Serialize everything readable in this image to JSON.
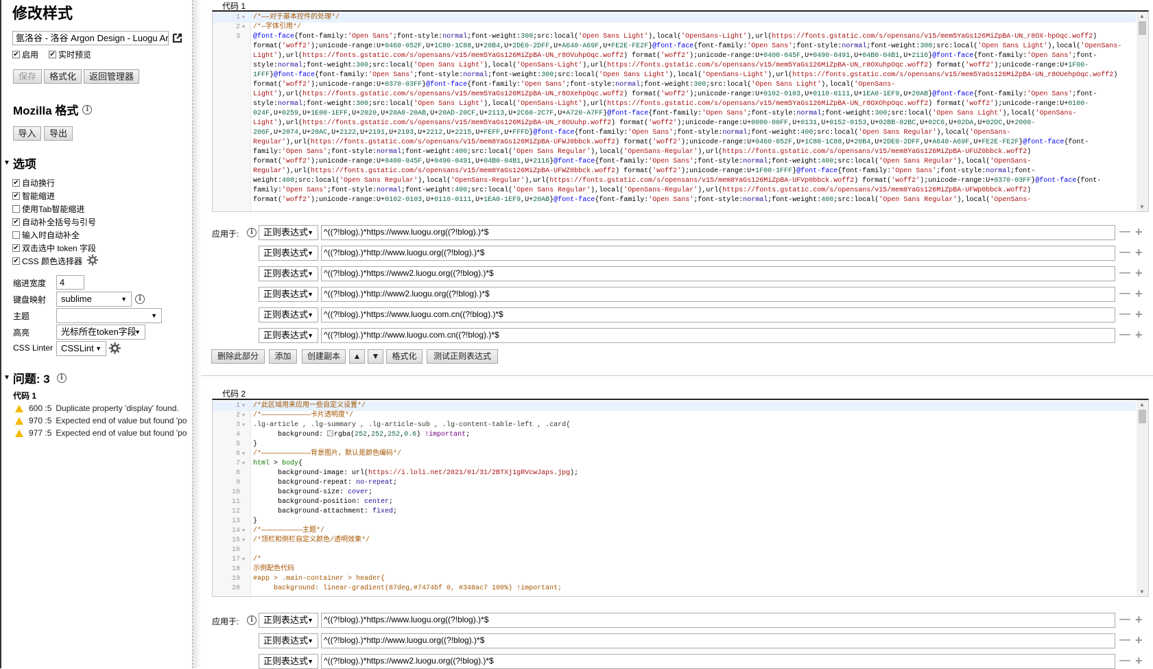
{
  "sidebar": {
    "title": "修改样式",
    "style_name": "氩洛谷 - 洛谷 Argon Design - Luogu Argo",
    "enabled_label": "启用",
    "live_preview_label": "实时预览",
    "save_label": "保存",
    "beautify_label": "格式化",
    "back_label": "返回管理器",
    "mozilla_title": "Mozilla 格式",
    "import_label": "导入",
    "export_label": "导出",
    "options_title": "选项",
    "options": [
      {
        "label": "自动换行",
        "checked": true
      },
      {
        "label": "智能缩进",
        "checked": true
      },
      {
        "label": "使用Tab智能缩进",
        "checked": false
      },
      {
        "label": "自动补全括号与引号",
        "checked": true
      },
      {
        "label": "输入时自动补全",
        "checked": false
      },
      {
        "label": "双击选中 token 字段",
        "checked": true
      },
      {
        "label": "CSS 颜色选择器",
        "checked": true
      }
    ],
    "indent_label": "缩进宽度",
    "indent_value": "4",
    "keymap_label": "键盘映射",
    "keymap_value": "sublime",
    "theme_label": "主题",
    "theme_value": "",
    "highlight_label": "高亮",
    "highlight_value": "光标所在token字段",
    "linter_label": "CSS Linter",
    "linter_value": "CSSLint",
    "issues_title": "问题: 3",
    "issues_section": "代码 1",
    "issues": [
      {
        "pos": "600 :5",
        "msg": "Duplicate property 'display' found."
      },
      {
        "pos": "970 :5",
        "msg": "Expected end of value but found 'po"
      },
      {
        "pos": "977 :5",
        "msg": "Expected end of value but found 'po"
      }
    ]
  },
  "sections": [
    {
      "label": "代码 1",
      "rows": [
        {
          "n": "1",
          "fold": true,
          "t": "/*——对于基本控件的处理*/"
        },
        {
          "n": "2",
          "fold": true,
          "t": "/*—字体引用*/"
        },
        {
          "n": "3",
          "fold": false,
          "t": "@font-face{font-family:'Open Sans';font-style:normal;font-weight:300;src:local('Open Sans Light'),local('OpenSans-Light'),url(https://fonts.gstatic.com/s/opensans/v15/mem5YaGs126MiZpBA-UN_r8OX-hpOqc.woff2)"
        },
        {
          "n": "",
          "t": "format('woff2');unicode-range:U+0460-052F,U+1C80-1C88,U+20B4,U+2DE0-2DFF,U+A640-A69F,U+FE2E-FE2F}@font-face{font-family:'Open Sans';font-style:normal;font-weight:300;src:local('Open Sans Light'),local('OpenSans-"
        },
        {
          "n": "",
          "t": "Light'),url(https://fonts.gstatic.com/s/opensans/v15/mem5YaGs126MiZpBA-UN_r8OVuhpOqc.woff2) format('woff2');unicode-range:U+0400-045F,U+0490-0491,U+04B0-04B1,U+2116}@font-face{font-family:'Open Sans';font-"
        },
        {
          "n": "",
          "t": "style:normal;font-weight:300;src:local('Open Sans Light'),local('OpenSans-Light'),url(https://fonts.gstatic.com/s/opensans/v15/mem5YaGs126MiZpBA-UN_r8OXuhpOqc.woff2) format('woff2');unicode-range:U+1F00-"
        },
        {
          "n": "",
          "t": "1FFF}@font-face{font-family:'Open Sans';font-style:normal;font-weight:300;src:local('Open Sans Light'),local('OpenSans-Light'),url(https://fonts.gstatic.com/s/opensans/v15/mem5YaGs126MiZpBA-UN_r8OUehpOqc.woff2)"
        },
        {
          "n": "",
          "t": "format('woff2');unicode-range:U+0370-03FF}@font-face{font-family:'Open Sans';font-style:normal;font-weight:300;src:local('Open Sans Light'),local('OpenSans-"
        },
        {
          "n": "",
          "t": "Light'),url(https://fonts.gstatic.com/s/opensans/v15/mem5YaGs126MiZpBA-UN_r8OXehpOqc.woff2) format('woff2');unicode-range:U+0102-0103,U+0110-0111,U+1EA0-1EF9,U+20AB}@font-face{font-family:'Open Sans';font-"
        },
        {
          "n": "",
          "t": "style:normal;font-weight:300;src:local('Open Sans Light'),local('OpenSans-Light'),url(https://fonts.gstatic.com/s/opensans/v15/mem5YaGs126MiZpBA-UN_r8OXOhpOqc.woff2) format('woff2');unicode-range:U+0100-"
        },
        {
          "n": "",
          "t": "024F,U+0259,U+1E00-1EFF,U+2020,U+20A0-20AB,U+20AD-20CF,U+2113,U+2C60-2C7F,U+A720-A7FF}@font-face{font-family:'Open Sans';font-style:normal;font-weight:300;src:local('Open Sans Light'),local('OpenSans-"
        },
        {
          "n": "",
          "t": "Light'),url(https://fonts.gstatic.com/s/opensans/v15/mem5YaGs126MiZpBA-UN_r8OUuhp.woff2) format('woff2');unicode-range:U+0000-00FF,U+0131,U+0152-0153,U+02BB-02BC,U+02C6,U+02DA,U+02DC,U+2000-"
        },
        {
          "n": "",
          "t": "206F,U+2074,U+20AC,U+2122,U+2191,U+2193,U+2212,U+2215,U+FEFF,U+FFFD}@font-face{font-family:'Open Sans';font-style:normal;font-weight:400;src:local('Open Sans Regular'),local('OpenSans-"
        },
        {
          "n": "",
          "t": "Regular'),url(https://fonts.gstatic.com/s/opensans/v15/mem8YaGs126MiZpBA-UFWJ0bbck.woff2) format('woff2');unicode-range:U+0460-052F,U+1C80-1C88,U+20B4,U+2DE0-2DFF,U+A640-A69F,U+FE2E-FE2F}@font-face{font-"
        },
        {
          "n": "",
          "t": "family:'Open Sans';font-style:normal;font-weight:400;src:local('Open Sans Regular'),local('OpenSans-Regular'),url(https://fonts.gstatic.com/s/opensans/v15/mem8YaGs126MiZpBA-UFUZ0bbck.woff2)"
        },
        {
          "n": "",
          "t": "format('woff2');unicode-range:U+0400-045F,U+0490-0491,U+04B0-04B1,U+2116}@font-face{font-family:'Open Sans';font-style:normal;font-weight:400;src:local('Open Sans Regular'),local('OpenSans-"
        },
        {
          "n": "",
          "t": "Regular'),url(https://fonts.gstatic.com/s/opensans/v15/mem8YaGs126MiZpBA-UFWZ0bbck.woff2) format('woff2');unicode-range:U+1F00-1FFF}@font-face{font-family:'Open Sans';font-style:normal;font-"
        },
        {
          "n": "",
          "t": "weight:400;src:local('Open Sans Regular'),local('OpenSans-Regular'),url(https://fonts.gstatic.com/s/opensans/v15/mem8YaGs126MiZpBA-UFVp0bbck.woff2) format('woff2');unicode-range:U+0370-03FF}@font-face{font-"
        },
        {
          "n": "",
          "t": "family:'Open Sans';font-style:normal;font-weight:400;src:local('Open Sans Regular'),local('OpenSans-Regular'),url(https://fonts.gstatic.com/s/opensans/v15/mem8YaGs126MiZpBA-UFWp0bbck.woff2)"
        },
        {
          "n": "",
          "t": "format('woff2');unicode-range:U+0102-0103,U+0110-0111,U+1EA0-1EF9,U+20AB}@font-face{font-family:'Open Sans';font-style:normal;font-weight:400;src:local('Open Sans Regular'),local('OpenSans-"
        }
      ],
      "applies_label": "应用于:",
      "applies": [
        {
          "type": "正则表达式",
          "value": "^((?!blog).)*https://www.luogu.org((?!blog).)*$"
        },
        {
          "type": "正则表达式",
          "value": "^((?!blog).)*http://www.luogu.org((?!blog).)*$"
        },
        {
          "type": "正则表达式",
          "value": "^((?!blog).)*https://www2.luogu.org((?!blog).)*$"
        },
        {
          "type": "正则表达式",
          "value": "^((?!blog).)*http://www2.luogu.org((?!blog).)*$"
        },
        {
          "type": "正则表达式",
          "value": "^((?!blog).)*https://www.luogu.com.cn((?!blog).)*$"
        },
        {
          "type": "正则表达式",
          "value": "^((?!blog).)*http://www.luogu.com.cn((?!blog).)*$"
        }
      ],
      "buttons": [
        "删除此部分",
        "添加",
        "创建副本",
        "▲",
        "▼",
        "格式化",
        "测试正则表达式"
      ]
    },
    {
      "label": "代码 2",
      "rows": [
        {
          "n": "1",
          "fold": true,
          "t": "/*此区域用来应用一些自定义设置*/"
        },
        {
          "n": "2",
          "fold": true,
          "t": "/*————————————卡片透明度*/"
        },
        {
          "n": "3",
          "fold": true,
          "t": ".lg-article , .lg-summary , .lg-article-sub , .lg-content-table-left , .card{"
        },
        {
          "n": "4",
          "fold": false,
          "t": "      background: rgba(252,252,252,0.6) !important;"
        },
        {
          "n": "5",
          "fold": false,
          "t": "}"
        },
        {
          "n": "6",
          "fold": true,
          "t": "/*————————————背景图片，默认是颜色编码*/"
        },
        {
          "n": "7",
          "fold": true,
          "t": "html > body{"
        },
        {
          "n": "8",
          "fold": false,
          "t": "      background-image: url(https://i.loli.net/2021/01/31/2BTXj1gRVcwJaps.jpg);"
        },
        {
          "n": "9",
          "fold": false,
          "t": "      background-repeat: no-repeat;"
        },
        {
          "n": "10",
          "fold": false,
          "t": "      background-size: cover;"
        },
        {
          "n": "11",
          "fold": false,
          "t": "      background-position: center;"
        },
        {
          "n": "12",
          "fold": false,
          "t": "      background-attachment: fixed;"
        },
        {
          "n": "13",
          "fold": false,
          "t": "}"
        },
        {
          "n": "14",
          "fold": true,
          "t": "/*——————————主题*/"
        },
        {
          "n": "15",
          "fold": true,
          "t": "/*顶栏和侧栏自定义颜色/透明效果*/"
        },
        {
          "n": "16",
          "fold": false,
          "t": ""
        },
        {
          "n": "17",
          "fold": true,
          "t": "/*"
        },
        {
          "n": "18",
          "fold": false,
          "t": "示例配色代码"
        },
        {
          "n": "19",
          "fold": false,
          "t": "#app > .main-container > header{"
        },
        {
          "n": "20",
          "fold": false,
          "t": "     background: linear-gradient(87deg,#7474bf 0, #348ac7 100%) !important;"
        }
      ],
      "applies_label": "应用于:",
      "applies": [
        {
          "type": "正则表达式",
          "value": "^((?!blog).)*https://www.luogu.org((?!blog).)*$"
        },
        {
          "type": "正则表达式",
          "value": "^((?!blog).)*http://www.luogu.org((?!blog).)*$"
        },
        {
          "type": "正则表达式",
          "value": "^((?!blog).)*https://www2.luogu.org((?!blog).)*$"
        }
      ]
    }
  ],
  "colors": {
    "comment": "#a55500",
    "at_rule": "#0000ee",
    "string": "#aa1111",
    "number": "#116644",
    "keyword": "#221199",
    "warning": "#f5b800"
  }
}
